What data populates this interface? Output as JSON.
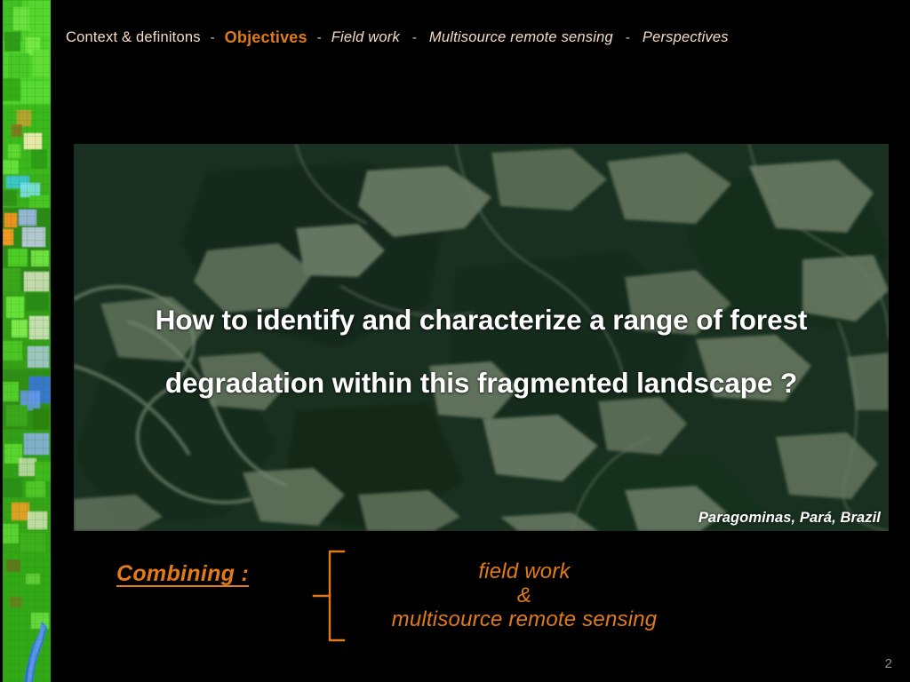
{
  "slide": {
    "page_number": "2",
    "background_color": "#000000"
  },
  "nav": {
    "separator": "-",
    "items": [
      {
        "label": "Context & definitons",
        "style": "plain",
        "active": false
      },
      {
        "label": "Objectives",
        "style": "bold",
        "active": true
      },
      {
        "label": "Field work",
        "style": "italic",
        "active": false
      },
      {
        "label": "Multisource  remote sensing",
        "style": "italic",
        "active": false
      },
      {
        "label": "Perspectives",
        "style": "italic",
        "active": false
      }
    ],
    "active_color": "#e07b18",
    "inactive_color": "#f6dcc4"
  },
  "headline": {
    "line1": "How to identify and characterize a range of forest",
    "line2": "degradation within this fragmented landscape ?",
    "color": "#ffffff"
  },
  "image_panel": {
    "name": "satellite-imagery-paragominas",
    "caption": "Paragominas, Pará, Brazil",
    "caption_color": "#ffffff"
  },
  "sidebar": {
    "name": "landcover-classification-strip"
  },
  "combining": {
    "label": "Combining :",
    "label_color": "#e07b18",
    "items": [
      {
        "text": "field work"
      },
      {
        "text": "&"
      },
      {
        "text": "multisource remote sensing"
      }
    ],
    "brace_color": "#e07b18"
  }
}
